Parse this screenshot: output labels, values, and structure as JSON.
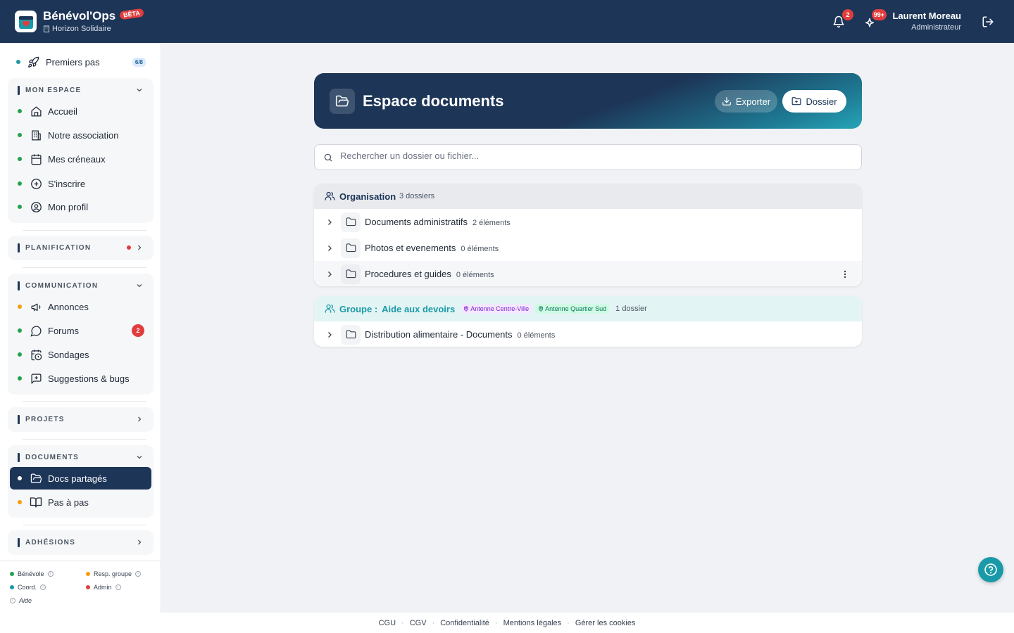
{
  "header": {
    "app_name": "Bénévol'Ops",
    "beta_label": "BÊTA",
    "org_name": "Horizon Solidaire",
    "notifications_count": "2",
    "updates_count": "99+",
    "user_name": "Laurent Moreau",
    "user_role": "Administrateur"
  },
  "sidebar": {
    "first_steps": {
      "label": "Premiers pas",
      "progress": "6/8",
      "dot_color": "#1a9aa8"
    },
    "sections": {
      "mon_espace": {
        "title": "MON ESPACE",
        "items": [
          {
            "label": "Accueil",
            "icon": "home-icon"
          },
          {
            "label": "Notre association",
            "icon": "building-icon"
          },
          {
            "label": "Mes créneaux",
            "icon": "calendar-icon"
          },
          {
            "label": "S'inscrire",
            "icon": "plus-circle-icon"
          },
          {
            "label": "Mon profil",
            "icon": "user-circle-icon"
          }
        ]
      },
      "planification": {
        "title": "PLANIFICATION"
      },
      "communication": {
        "title": "COMMUNICATION",
        "items": [
          {
            "label": "Annonces",
            "icon": "megaphone-icon"
          },
          {
            "label": "Forums",
            "icon": "chat-icon",
            "badge": "2"
          },
          {
            "label": "Sondages",
            "icon": "calendar-clock-icon"
          },
          {
            "label": "Suggestions & bugs",
            "icon": "message-plus-icon"
          }
        ]
      },
      "projets": {
        "title": "PROJETS"
      },
      "documents": {
        "title": "DOCUMENTS",
        "items": [
          {
            "label": "Docs partagés",
            "icon": "folder-open-icon",
            "active": true
          },
          {
            "label": "Pas à pas",
            "icon": "book-icon"
          }
        ]
      },
      "adhesions": {
        "title": "ADHÉSIONS"
      }
    },
    "legend": {
      "benevole": "Bénévole",
      "resp_groupe": "Resp. groupe",
      "coord": "Coord.",
      "admin": "Admin",
      "aide": "Aide"
    }
  },
  "colors": {
    "navy": "#1d3557",
    "green": "#22a34a",
    "orange": "#f59e0b",
    "teal": "#1a9aa8",
    "red": "#e03e3e"
  },
  "main": {
    "title": "Espace documents",
    "export_label": "Exporter",
    "new_folder_label": "Dossier",
    "search_placeholder": "Rechercher un dossier ou fichier...",
    "groups": [
      {
        "label": "Organisation",
        "count": "3 dossiers",
        "folders": [
          {
            "name": "Documents administratifs",
            "count": "2 éléments"
          },
          {
            "name": "Photos et evenements",
            "count": "0 éléments"
          },
          {
            "name": "Procedures et guides",
            "count": "0 éléments"
          }
        ]
      },
      {
        "label_prefix": "Groupe :",
        "label": "Aide aux devoirs",
        "tags": [
          "Antenne Centre-Ville",
          "Antenne Quartier Sud"
        ],
        "count": "1 dossier",
        "folders": [
          {
            "name": "Distribution alimentaire - Documents",
            "count": "0 éléments"
          }
        ]
      }
    ]
  },
  "footer": {
    "links": [
      "CGU",
      "CGV",
      "Confidentialité",
      "Mentions légales",
      "Gérer les cookies"
    ]
  }
}
